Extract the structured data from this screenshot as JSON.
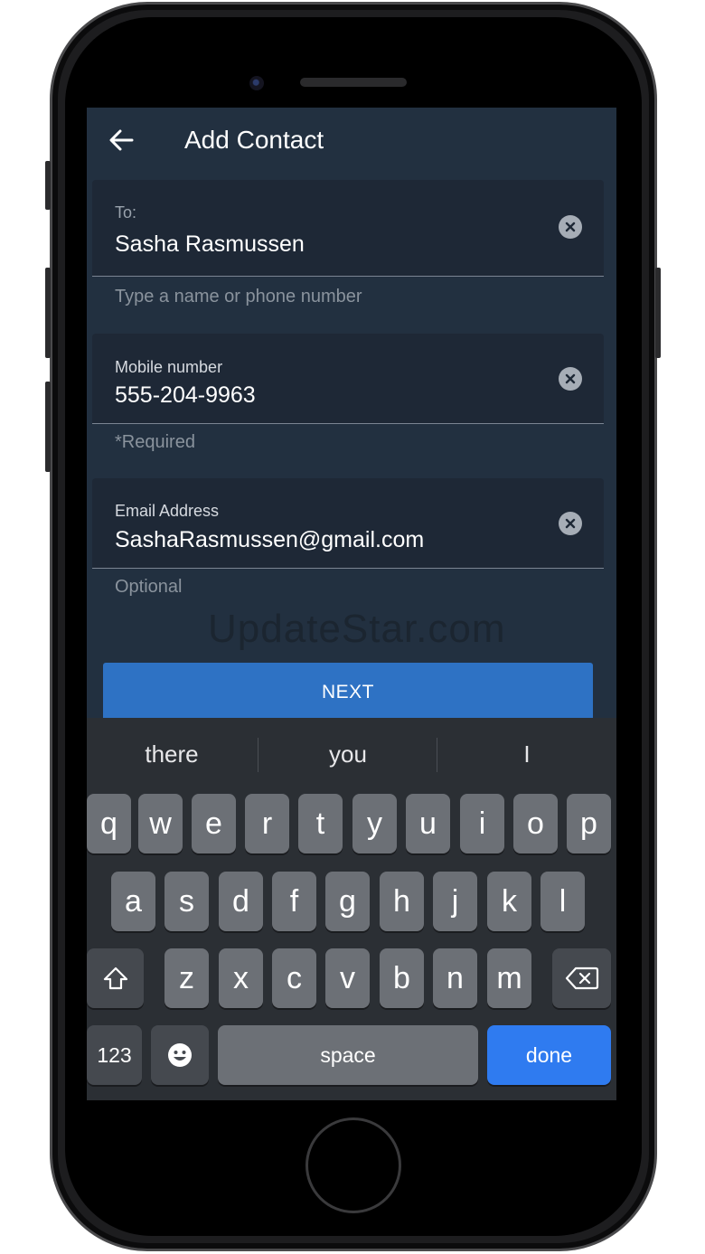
{
  "header": {
    "title": "Add Contact"
  },
  "fields": {
    "to": {
      "label": "To:",
      "value": "Sasha Rasmussen",
      "helper": "Type a name or phone number"
    },
    "mobile": {
      "label": "Mobile number",
      "value": "555-204-9963",
      "helper": "*Required"
    },
    "email": {
      "label": "Email Address",
      "value": "SashaRasmussen@gmail.com",
      "helper": "Optional"
    }
  },
  "watermark": "UpdateStar.com",
  "next_label": "NEXT",
  "keyboard": {
    "suggestions": [
      "there",
      "you",
      "I"
    ],
    "row1": [
      "q",
      "w",
      "e",
      "r",
      "t",
      "y",
      "u",
      "i",
      "o",
      "p"
    ],
    "row2": [
      "a",
      "s",
      "d",
      "f",
      "g",
      "h",
      "j",
      "k",
      "l"
    ],
    "row3": [
      "z",
      "x",
      "c",
      "v",
      "b",
      "n",
      "m"
    ],
    "numbers_label": "123",
    "space_label": "space",
    "done_label": "done"
  },
  "colors": {
    "screen_bg": "#223040",
    "field_bg": "#1e2836",
    "accent": "#2e72c4",
    "done_key": "#2f7bf0"
  }
}
